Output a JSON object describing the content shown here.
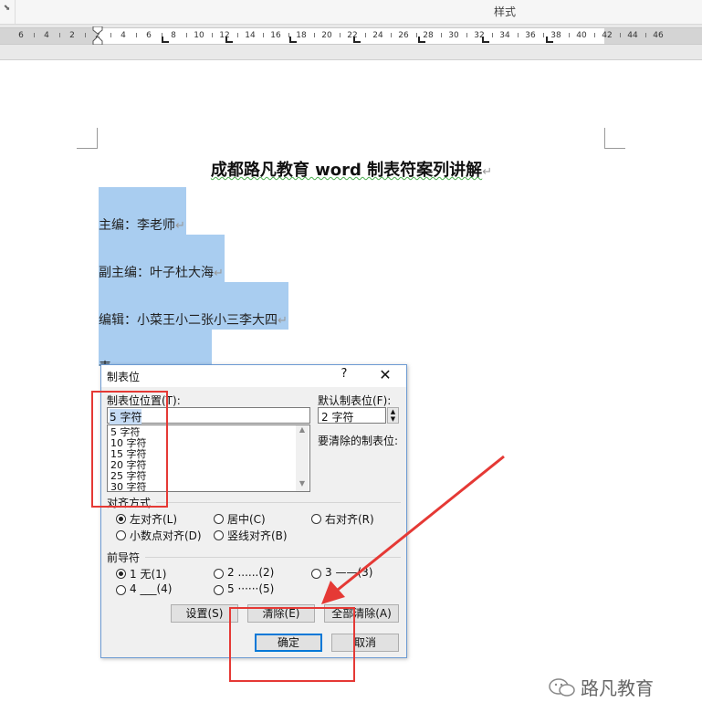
{
  "ribbon": {
    "styles_label": "样式",
    "corner_icon": "dialog-launcher-icon"
  },
  "ruler": {
    "labels": [
      "6",
      "4",
      "2",
      "2",
      "4",
      "6",
      "8",
      "10",
      "12",
      "14",
      "16",
      "18",
      "20",
      "22",
      "24",
      "26",
      "28",
      "30",
      "32",
      "34",
      "36",
      "38",
      "40",
      "42",
      "44",
      "46"
    ]
  },
  "document": {
    "title": "成都路凡教育 word 制表符案列讲解",
    "paragraph_mark": "↵",
    "lines": [
      "主编：李老师",
      "副主编：叶子杜大海",
      "编辑：小菜王小二张小三李大四",
      "责"
    ]
  },
  "dialog": {
    "title": "制表位",
    "help": "?",
    "close": "✕",
    "tab_position_label": "制表位位置(T):",
    "tab_position_value": "5 字符",
    "tab_list": [
      "5 字符",
      "10 字符",
      "15 字符",
      "20 字符",
      "25 字符",
      "30 字符"
    ],
    "default_tab_label": "默认制表位(F):",
    "default_tab_value": "2 字符",
    "clear_label": "要清除的制表位:",
    "alignment": {
      "label": "对齐方式",
      "options": [
        "左对齐(L)",
        "居中(C)",
        "右对齐(R)",
        "小数点对齐(D)",
        "竖线对齐(B)"
      ],
      "selected": "左对齐(L)"
    },
    "leader": {
      "label": "前导符",
      "options": [
        "1 无(1)",
        "2 ......(2)",
        "3 ——(3)",
        "4 ___(4)",
        "5 ······(5)"
      ],
      "selected": "1 无(1)"
    },
    "buttons": {
      "set": "设置(S)",
      "clear": "清除(E)",
      "clear_all": "全部清除(A)",
      "ok": "确定",
      "cancel": "取消"
    }
  },
  "annotation": {
    "color": "#e53935"
  },
  "watermark": {
    "text": "路凡教育"
  },
  "colors": {
    "selection": "#a9cdf0",
    "dialog_border": "#6d9bd3",
    "primary_button": "#0078d7"
  }
}
